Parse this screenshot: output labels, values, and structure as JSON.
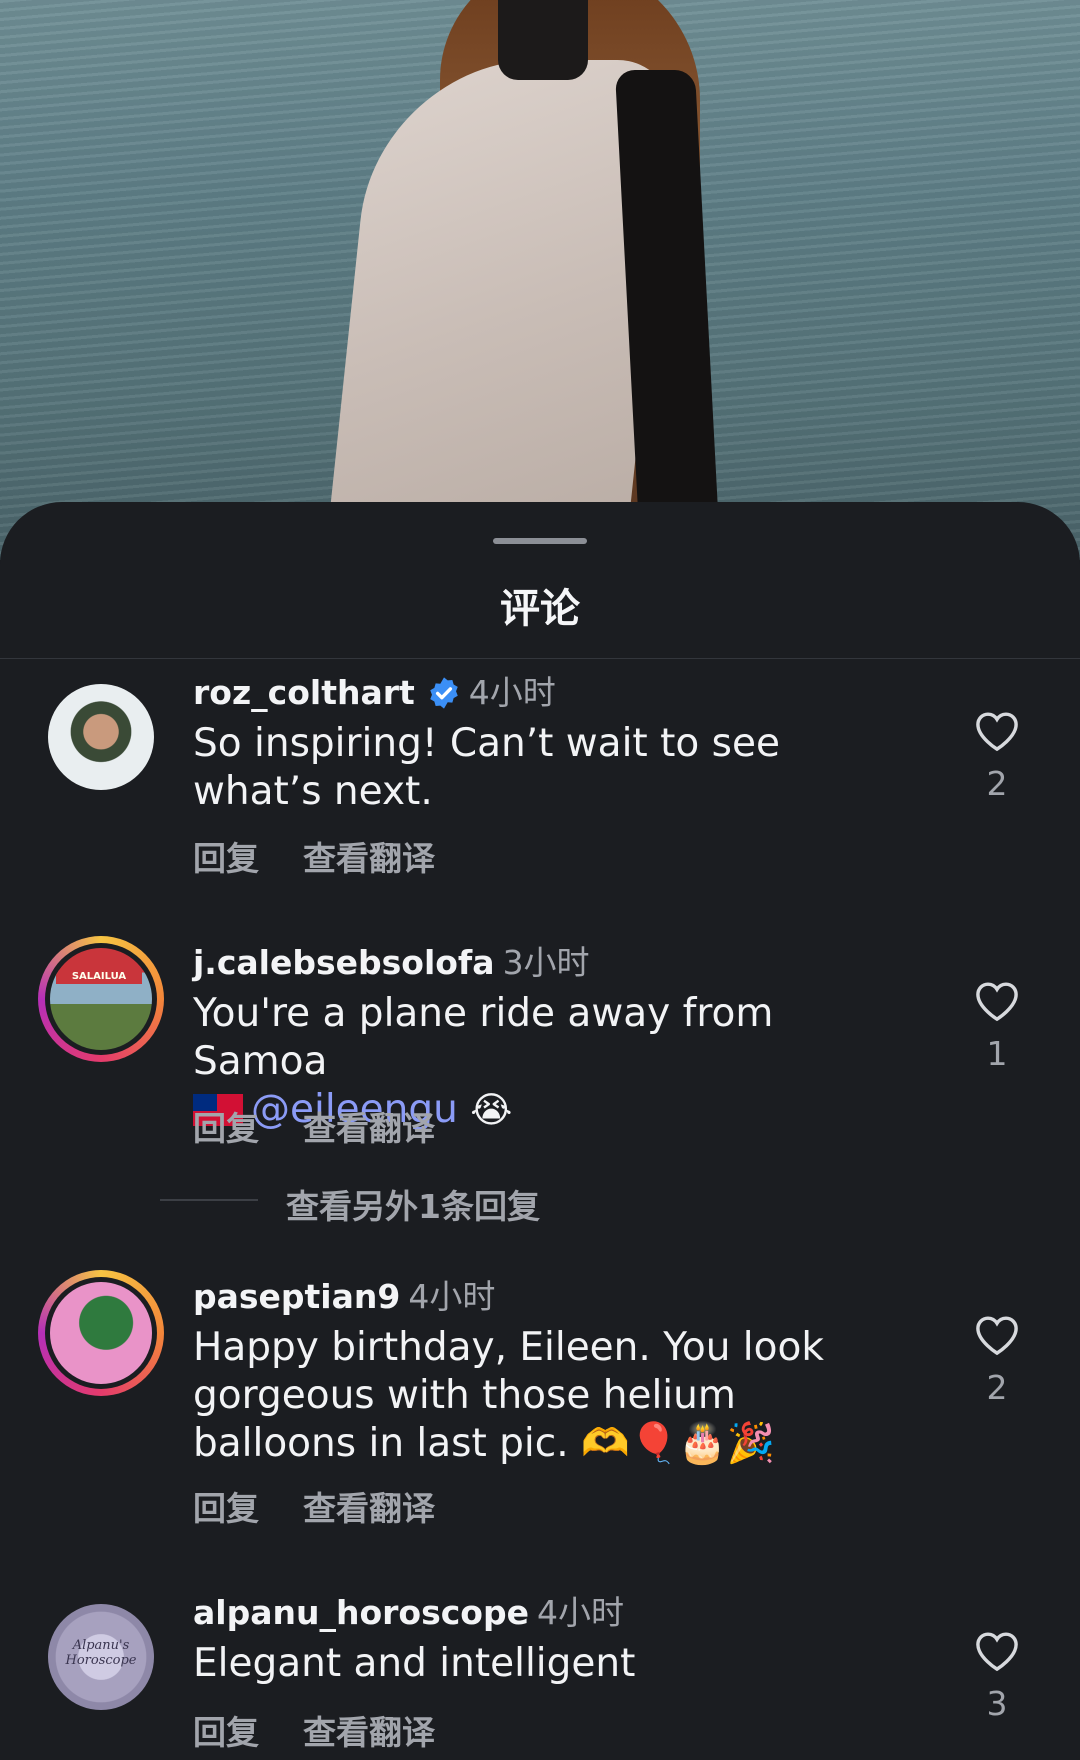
{
  "sheet": {
    "title": "评论"
  },
  "comments": [
    {
      "username": "roz_colthart",
      "verified": true,
      "time": "4小时",
      "text": "So inspiring! Can’t wait to see what’s next.",
      "reply_label": "回复",
      "translate_label": "查看翻译",
      "likes": "2"
    },
    {
      "username": "j.calebsebsolofa",
      "verified": false,
      "time": "3小时",
      "text": "You're a plane ride away from Samoa",
      "mention": "@eileengu",
      "reply_label": "回复",
      "translate_label": "查看翻译",
      "likes": "1",
      "avatar_sign": "SALAILUA"
    },
    {
      "username": "paseptian9",
      "verified": false,
      "time": "4小时",
      "text": "Happy birthday, Eileen. You look gorgeous with those helium balloons in last pic. 🫶🎈🎂🎉",
      "reply_label": "回复",
      "translate_label": "查看翻译",
      "likes": "2"
    },
    {
      "username": "alpanu_horoscope",
      "verified": false,
      "time": "4小时",
      "text": "Elegant and intelligent",
      "reply_label": "回复",
      "translate_label": "查看翻译",
      "likes": "3",
      "avatar_text": "Alpanu's Horoscope"
    }
  ],
  "more_replies": "查看另外1条回复",
  "icons": {
    "verified": "verified-badge-icon",
    "like": "heart-icon"
  },
  "colors": {
    "sheet_bg": "#1b1d21",
    "mention": "#8b9bf6",
    "verified": "#3b8ff6"
  }
}
